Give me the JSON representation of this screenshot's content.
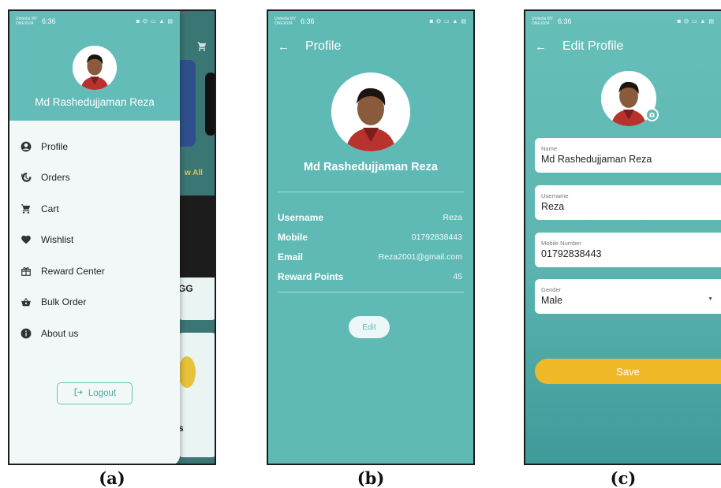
{
  "panels": {
    "a": {
      "caption": "(a)"
    },
    "b": {
      "caption": "(b)"
    },
    "c": {
      "caption": "(c)"
    }
  },
  "status_bar": {
    "time": "6:36",
    "operator": "Unitedia MY ONEX034",
    "icons": "◙ ⏣ ▭ ▲ ▤"
  },
  "drawer": {
    "user_name": "Md Rashedujjaman Reza",
    "items": [
      {
        "label": "Profile",
        "icon": "person-circle-icon"
      },
      {
        "label": "Orders",
        "icon": "history-icon"
      },
      {
        "label": "Cart",
        "icon": "cart-icon"
      },
      {
        "label": "Wishlist",
        "icon": "heart-icon"
      },
      {
        "label": "Reward Center",
        "icon": "gift-icon"
      },
      {
        "label": "Bulk Order",
        "icon": "basket-icon"
      },
      {
        "label": "About us",
        "icon": "info-icon"
      }
    ],
    "logout_label": "Logout",
    "bg_snippets": {
      "view_all": "w All",
      "gg": "GG",
      "s": "s"
    }
  },
  "profile": {
    "title": "Profile",
    "user_name": "Md Rashedujjaman Reza",
    "rows": [
      {
        "key": "Username",
        "value": "Reza"
      },
      {
        "key": "Mobile",
        "value": "01792838443"
      },
      {
        "key": "Email",
        "value": "Reza2001@gmail.com"
      },
      {
        "key": "Reward Points",
        "value": "45"
      }
    ],
    "edit_label": "Edit"
  },
  "edit_profile": {
    "title": "Edit Profile",
    "fields": [
      {
        "label": "Name",
        "value": "Md Rashedujjaman Reza"
      },
      {
        "label": "Username",
        "value": "Reza"
      },
      {
        "label": "Mobile Number",
        "value": "01792838443"
      },
      {
        "label": "Gender",
        "value": "Male"
      }
    ],
    "save_label": "Save"
  },
  "colors": {
    "teal": "#5fbab6",
    "drawer_bg": "#f2f8f8",
    "save": "#f0b928"
  }
}
